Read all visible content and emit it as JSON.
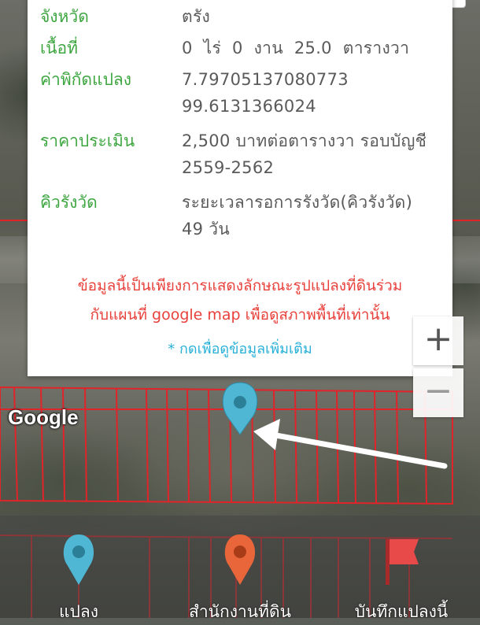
{
  "parcel_info": {
    "province_label": "จังหวัด",
    "province_value": "ตรัง",
    "area_label": "เนื้อที่",
    "area_value": "0  ไร่  0  งาน  25.0  ตารางวา",
    "coords_label": "ค่าพิกัดแปลง",
    "coords_lat": "7.79705137080773",
    "coords_lng": "99.6131366024",
    "price_label": "ราคาประเมิน",
    "price_line1": "2,500 บาทต่อตารางวา รอบบัญชี",
    "price_line2": "2559-2562",
    "queue_label": "คิวรังวัด",
    "queue_line1": "ระยะเวลารอการรังวัด(คิวรังวัด)",
    "queue_line2": "49 วัน"
  },
  "warning": {
    "line1": "ข้อมูลนี้เป็นเพียงการแสดงลักษณะรูปแปลงที่ดินร่วม",
    "line2": "กับแผนที่ google map เพื่อดูสภาพพื้นที่เท่านั้น"
  },
  "more_link": "* กดเพื่อดูข้อมูลเพิ่มเติม",
  "map": {
    "zoom_in": "+",
    "zoom_out": "−",
    "google_logo": "Google"
  },
  "bottom_nav": [
    {
      "label": "แปลง",
      "icon": "marker-blue-icon",
      "color": "#4fb6d3"
    },
    {
      "label": "สำนักงานที่ดิน",
      "icon": "marker-orange-icon",
      "color": "#e8663a"
    },
    {
      "label": "บันทึกแปลงนี้",
      "icon": "flag-icon",
      "color": "#e84a4a"
    }
  ],
  "colors": {
    "label_green": "#3ea641",
    "warning_red": "#e8413b",
    "link_blue": "#27b0d8",
    "parcel_line": "#e0242a"
  }
}
